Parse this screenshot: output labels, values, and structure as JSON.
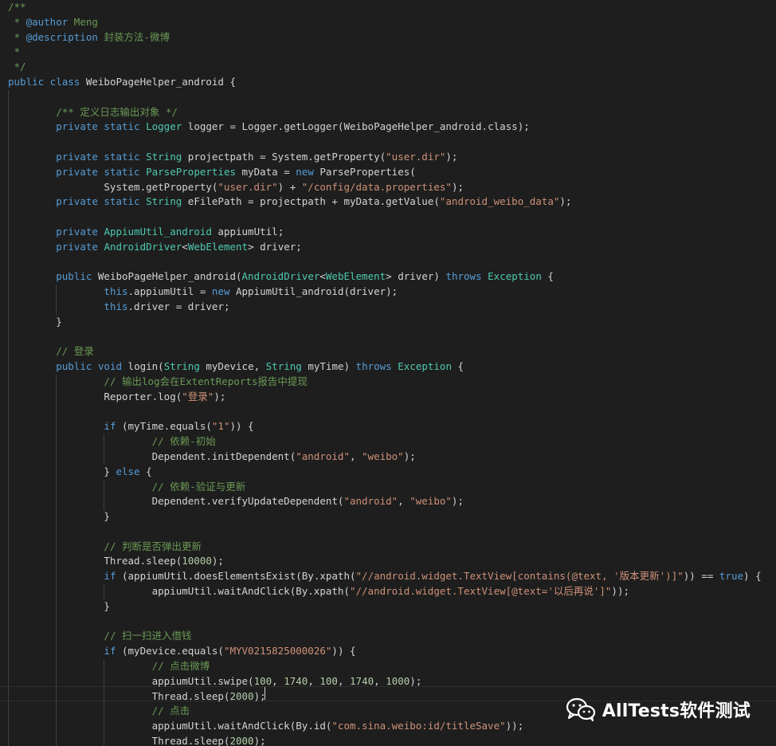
{
  "editor": {
    "lines": [
      [
        [
          "c",
          "/**"
        ]
      ],
      [
        [
          "c",
          " * "
        ],
        [
          "a",
          "@author"
        ],
        [
          "c",
          " Meng"
        ]
      ],
      [
        [
          "c",
          " * "
        ],
        [
          "a",
          "@description"
        ],
        [
          "c",
          " 封装方法-微博"
        ]
      ],
      [
        [
          "c",
          " *"
        ]
      ],
      [
        [
          "c",
          " */"
        ]
      ],
      [
        [
          "k",
          "public class"
        ],
        [
          "p",
          " WeiboPageHelper_android {"
        ]
      ],
      [],
      [
        [
          "p",
          "        "
        ],
        [
          "c",
          "/** 定义日志输出对象 */"
        ]
      ],
      [
        [
          "p",
          "        "
        ],
        [
          "k",
          "private static"
        ],
        [
          "p",
          " "
        ],
        [
          "t",
          "Logger"
        ],
        [
          "p",
          " logger = Logger.getLogger(WeiboPageHelper_android.class);"
        ]
      ],
      [],
      [
        [
          "p",
          "        "
        ],
        [
          "k",
          "private static"
        ],
        [
          "p",
          " "
        ],
        [
          "t",
          "String"
        ],
        [
          "p",
          " projectpath = System.getProperty("
        ],
        [
          "s",
          "\"user.dir\""
        ],
        [
          "p",
          ");"
        ]
      ],
      [
        [
          "p",
          "        "
        ],
        [
          "k",
          "private static"
        ],
        [
          "p",
          " "
        ],
        [
          "t",
          "ParseProperties"
        ],
        [
          "p",
          " myData = "
        ],
        [
          "k",
          "new"
        ],
        [
          "p",
          " ParseProperties("
        ]
      ],
      [
        [
          "p",
          "                System.getProperty("
        ],
        [
          "s",
          "\"user.dir\""
        ],
        [
          "p",
          ") + "
        ],
        [
          "s",
          "\"/config/data.properties\""
        ],
        [
          "p",
          ");"
        ]
      ],
      [
        [
          "p",
          "        "
        ],
        [
          "k",
          "private static"
        ],
        [
          "p",
          " "
        ],
        [
          "t",
          "String"
        ],
        [
          "p",
          " eFilePath = projectpath + myData.getValue("
        ],
        [
          "s",
          "\"android_weibo_data\""
        ],
        [
          "p",
          ");"
        ]
      ],
      [],
      [
        [
          "p",
          "        "
        ],
        [
          "k",
          "private"
        ],
        [
          "p",
          " "
        ],
        [
          "t",
          "AppiumUtil_android"
        ],
        [
          "p",
          " appiumUtil;"
        ]
      ],
      [
        [
          "p",
          "        "
        ],
        [
          "k",
          "private"
        ],
        [
          "p",
          " "
        ],
        [
          "t",
          "AndroidDriver"
        ],
        [
          "p",
          "<"
        ],
        [
          "t",
          "WebElement"
        ],
        [
          "p",
          "> driver;"
        ]
      ],
      [],
      [
        [
          "p",
          "        "
        ],
        [
          "k",
          "public"
        ],
        [
          "p",
          " WeiboPageHelper_android("
        ],
        [
          "t",
          "AndroidDriver"
        ],
        [
          "p",
          "<"
        ],
        [
          "t",
          "WebElement"
        ],
        [
          "p",
          "> driver) "
        ],
        [
          "k",
          "throws"
        ],
        [
          "p",
          " "
        ],
        [
          "t",
          "Exception"
        ],
        [
          "p",
          " {"
        ]
      ],
      [
        [
          "p",
          "                "
        ],
        [
          "k",
          "this"
        ],
        [
          "p",
          ".appiumUtil = "
        ],
        [
          "k",
          "new"
        ],
        [
          "p",
          " AppiumUtil_android(driver);"
        ]
      ],
      [
        [
          "p",
          "                "
        ],
        [
          "k",
          "this"
        ],
        [
          "p",
          ".driver = driver;"
        ]
      ],
      [
        [
          "p",
          "        }"
        ]
      ],
      [],
      [
        [
          "p",
          "        "
        ],
        [
          "c",
          "// 登录"
        ]
      ],
      [
        [
          "p",
          "        "
        ],
        [
          "k",
          "public void"
        ],
        [
          "p",
          " login("
        ],
        [
          "t",
          "String"
        ],
        [
          "p",
          " myDevice, "
        ],
        [
          "t",
          "String"
        ],
        [
          "p",
          " myTime) "
        ],
        [
          "k",
          "throws"
        ],
        [
          "p",
          " "
        ],
        [
          "t",
          "Exception"
        ],
        [
          "p",
          " {"
        ]
      ],
      [
        [
          "p",
          "                "
        ],
        [
          "c",
          "// 输出log会在ExtentReports报告中提现"
        ]
      ],
      [
        [
          "p",
          "                Reporter.log("
        ],
        [
          "s",
          "\"登录\""
        ],
        [
          "p",
          ");"
        ]
      ],
      [],
      [
        [
          "p",
          "                "
        ],
        [
          "k",
          "if"
        ],
        [
          "p",
          " (myTime.equals("
        ],
        [
          "s",
          "\"1\""
        ],
        [
          "p",
          ")) {"
        ]
      ],
      [
        [
          "p",
          "                        "
        ],
        [
          "c",
          "// 依赖-初始"
        ]
      ],
      [
        [
          "p",
          "                        Dependent.initDependent("
        ],
        [
          "s",
          "\"android\""
        ],
        [
          "p",
          ", "
        ],
        [
          "s",
          "\"weibo\""
        ],
        [
          "p",
          ");"
        ]
      ],
      [
        [
          "p",
          "                } "
        ],
        [
          "k",
          "else"
        ],
        [
          "p",
          " {"
        ]
      ],
      [
        [
          "p",
          "                        "
        ],
        [
          "c",
          "// 依赖-验证与更新"
        ]
      ],
      [
        [
          "p",
          "                        Dependent.verifyUpdateDependent("
        ],
        [
          "s",
          "\"android\""
        ],
        [
          "p",
          ", "
        ],
        [
          "s",
          "\"weibo\""
        ],
        [
          "p",
          ");"
        ]
      ],
      [
        [
          "p",
          "                }"
        ]
      ],
      [],
      [
        [
          "p",
          "                "
        ],
        [
          "c",
          "// 判断是否弹出更新"
        ]
      ],
      [
        [
          "p",
          "                Thread.sleep("
        ],
        [
          "n",
          "10000"
        ],
        [
          "p",
          ");"
        ]
      ],
      [
        [
          "p",
          "                "
        ],
        [
          "k",
          "if"
        ],
        [
          "p",
          " (appiumUtil.doesElementsExist(By.xpath("
        ],
        [
          "s",
          "\"//android.widget.TextView[contains(@text, '版本更新')]\""
        ],
        [
          "p",
          ")) == "
        ],
        [
          "k",
          "true"
        ],
        [
          "p",
          ") {"
        ]
      ],
      [
        [
          "p",
          "                        appiumUtil.waitAndClick(By.xpath("
        ],
        [
          "s",
          "\"//android.widget.TextView[@text='以后再说']\""
        ],
        [
          "p",
          "));"
        ]
      ],
      [
        [
          "p",
          "                }"
        ]
      ],
      [],
      [
        [
          "p",
          "                "
        ],
        [
          "c",
          "// 扫一扫进入借钱"
        ]
      ],
      [
        [
          "p",
          "                "
        ],
        [
          "k",
          "if"
        ],
        [
          "p",
          " (myDevice.equals("
        ],
        [
          "s",
          "\"MYV0215825000026\""
        ],
        [
          "p",
          ")) {"
        ]
      ],
      [
        [
          "p",
          "                        "
        ],
        [
          "c",
          "// 点击微博"
        ]
      ],
      [
        [
          "p",
          "                        appiumUtil.swipe("
        ],
        [
          "n",
          "100"
        ],
        [
          "p",
          ", "
        ],
        [
          "n",
          "1740"
        ],
        [
          "p",
          ", "
        ],
        [
          "n",
          "100"
        ],
        [
          "p",
          ", "
        ],
        [
          "n",
          "1740"
        ],
        [
          "p",
          ", "
        ],
        [
          "n",
          "1000"
        ],
        [
          "p",
          ");"
        ]
      ],
      [
        [
          "p",
          "                        Thread.sleep("
        ],
        [
          "n",
          "2000"
        ],
        [
          "p",
          ");"
        ]
      ],
      [
        [
          "p",
          "                        "
        ],
        [
          "c",
          "// 点击"
        ]
      ],
      [
        [
          "p",
          "                        appiumUtil.waitAndClick(By.id("
        ],
        [
          "s",
          "\"com.sina.weibo:id/titleSave\""
        ],
        [
          "p",
          "));"
        ]
      ],
      [
        [
          "p",
          "                        Thread.sleep("
        ],
        [
          "n",
          "2000"
        ],
        [
          "p",
          ");"
        ]
      ]
    ]
  },
  "watermark": {
    "text": "AllTests软件测试",
    "icon": "wechat-icon"
  },
  "colors": {
    "background": "#1e1e1e",
    "comment": "#6a9955",
    "keyword": "#569cd6",
    "type": "#4ec9b0",
    "string": "#ce9178",
    "number": "#b5cea8",
    "text": "#d4d4d4"
  }
}
